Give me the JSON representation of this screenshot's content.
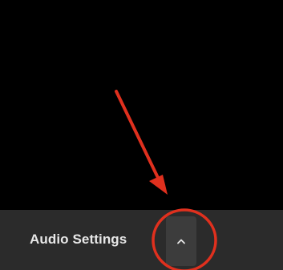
{
  "toolbar": {
    "audio_settings_label": "Audio Settings",
    "chevron_icon": "chevron-up-icon"
  },
  "annotation": {
    "color": "#e0301e",
    "arrow_icon": "red-arrow",
    "highlight_icon": "red-circle"
  },
  "colors": {
    "background": "#000000",
    "toolbar": "#2b2b2b",
    "button": "#3c3c3c",
    "label": "#e8e8e8"
  }
}
